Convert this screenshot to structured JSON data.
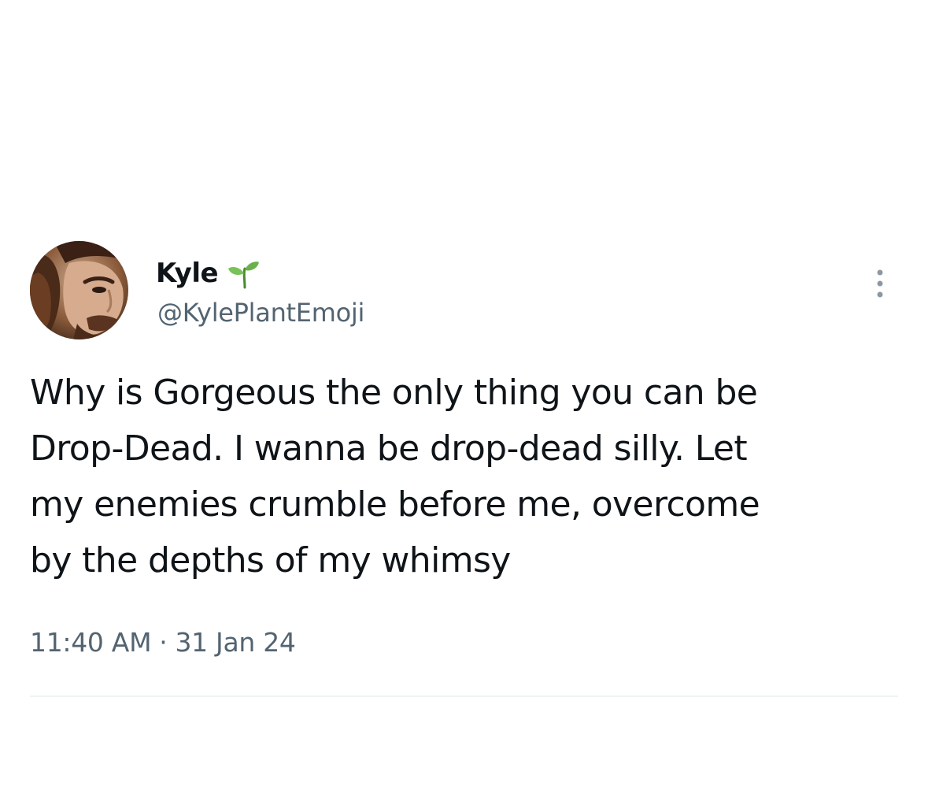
{
  "author": {
    "display_name": "Kyle",
    "name_emoji": "seedling-icon",
    "handle": "@KylePlantEmoji"
  },
  "tweet": {
    "text_lines": [
      "Why is Gorgeous the only thing you can be",
      "Drop-Dead. I wanna be drop-dead silly. Let",
      "my enemies crumble before me, overcome",
      "by the depths of my whimsy"
    ],
    "time": "11:40 AM",
    "separator": "·",
    "date": "31 Jan 24"
  },
  "icons": {
    "more": "more-vertical-icon",
    "avatar": "avatar"
  },
  "colors": {
    "text_primary": "#0f1419",
    "text_secondary": "#536471",
    "divider": "#eff3f4",
    "seedling_green": "#6ab04c"
  }
}
